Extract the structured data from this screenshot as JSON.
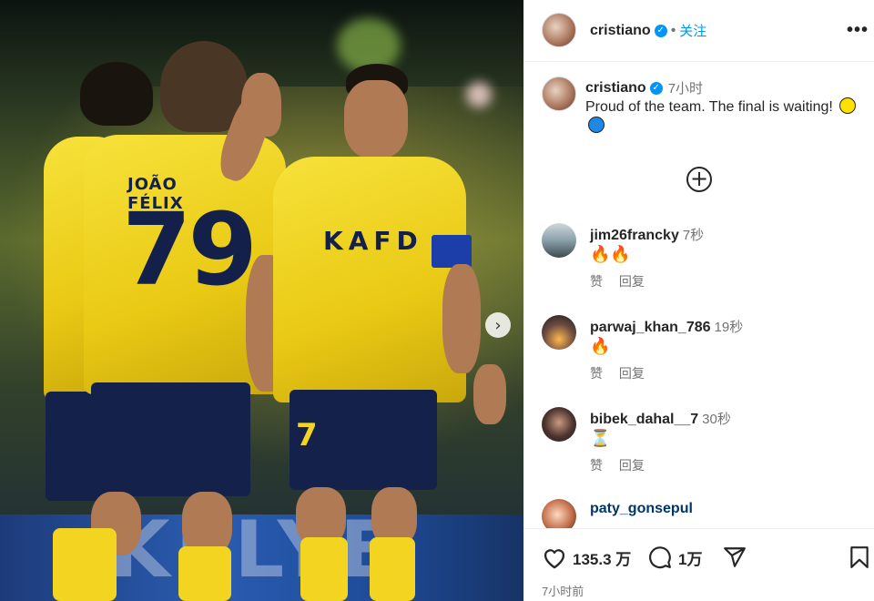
{
  "post": {
    "owner": "cristiano",
    "follow_label": "关注",
    "separator": "•",
    "more_label": "•••"
  },
  "photo": {
    "sponsor": "KAFD",
    "jersey_name": "JOÃO FÉLIX",
    "jersey_number": "79",
    "short_number": "7",
    "board_text": "KELYE",
    "next_glyph": "›"
  },
  "caption": {
    "user": "cristiano",
    "time": "7小时",
    "text": "Proud of the team. The final is waiting!"
  },
  "load_more_glyph": "+",
  "comments": [
    {
      "user": "jim26francky",
      "time": "7秒",
      "text": "🔥🔥",
      "like": "赞",
      "reply": "回复"
    },
    {
      "user": "parwaj_khan_786",
      "time": "19秒",
      "text": "🔥",
      "like": "赞",
      "reply": "回复"
    },
    {
      "user": "bibek_dahal__7",
      "time": "30秒",
      "text": "⏳",
      "like": "赞",
      "reply": "回复"
    },
    {
      "user": "paty_gonsepul",
      "time": "",
      "text": "",
      "like": "",
      "reply": ""
    }
  ],
  "actions": {
    "likes": "135.3 万",
    "comments": "1万",
    "posted": "7小时前"
  },
  "icons": [
    "heart-icon",
    "comment-icon",
    "share-icon",
    "bookmark-icon",
    "verified-icon",
    "more-icon",
    "add-circle-icon",
    "chevron-right-icon"
  ],
  "colors": {
    "accent": "#0095f6",
    "text": "#262626",
    "muted": "#737373",
    "jersey": "#f2d421",
    "navy": "#14214a"
  }
}
